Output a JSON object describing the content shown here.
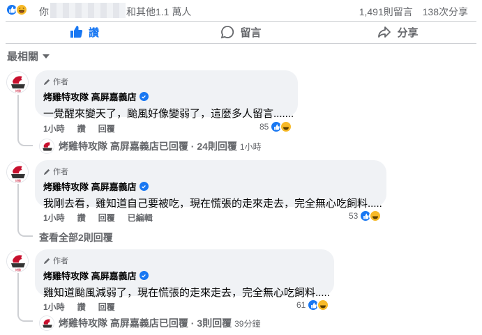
{
  "summary": {
    "you": "你",
    "others": "和其他1.1 萬人",
    "comments_count": "1,491則留言",
    "shares_count": "138次分享"
  },
  "actions": {
    "like": "讚",
    "comment": "留言",
    "share": "分享"
  },
  "sort": {
    "label": "最相關"
  },
  "colors": {
    "accent": "#1877f2",
    "muted": "#65676b",
    "bubble": "#f0f2f5"
  },
  "comments": [
    {
      "author_badge": "作者",
      "name": "烤雞特攻隊 高屏嘉義店",
      "text": "一覺醒來變天了，颱風好像變弱了，這麼多人留言.......",
      "time": "1小時",
      "like": "讚",
      "reply": "回覆",
      "reaction_count": "85",
      "reply_summary": {
        "name": "烤雞特攻隊 高屏嘉義店已回覆 · 24則回覆",
        "ago": "1小時"
      }
    },
    {
      "author_badge": "作者",
      "name": "烤雞特攻隊 高屏嘉義店",
      "text": "我剛去看，雞知道自己要被吃，現在慌張的走來走去，完全無心吃飼料.....",
      "time": "1小時",
      "like": "讚",
      "reply": "回覆",
      "edited": "已編輯",
      "reaction_count": "53",
      "view_all": "查看全部2則回覆"
    },
    {
      "author_badge": "作者",
      "name": "烤雞特攻隊 高屏嘉義店",
      "text": "雞知道颱風減弱了，現在慌張的走來走去，完全無心吃飼料.....",
      "time": "1小時",
      "like": "讚",
      "reply": "回覆",
      "reaction_count": "61",
      "reply_summary": {
        "name": "烤雞特攻隊 高屏嘉義店已回覆 · 3則回覆",
        "ago": "39分鐘"
      }
    }
  ]
}
